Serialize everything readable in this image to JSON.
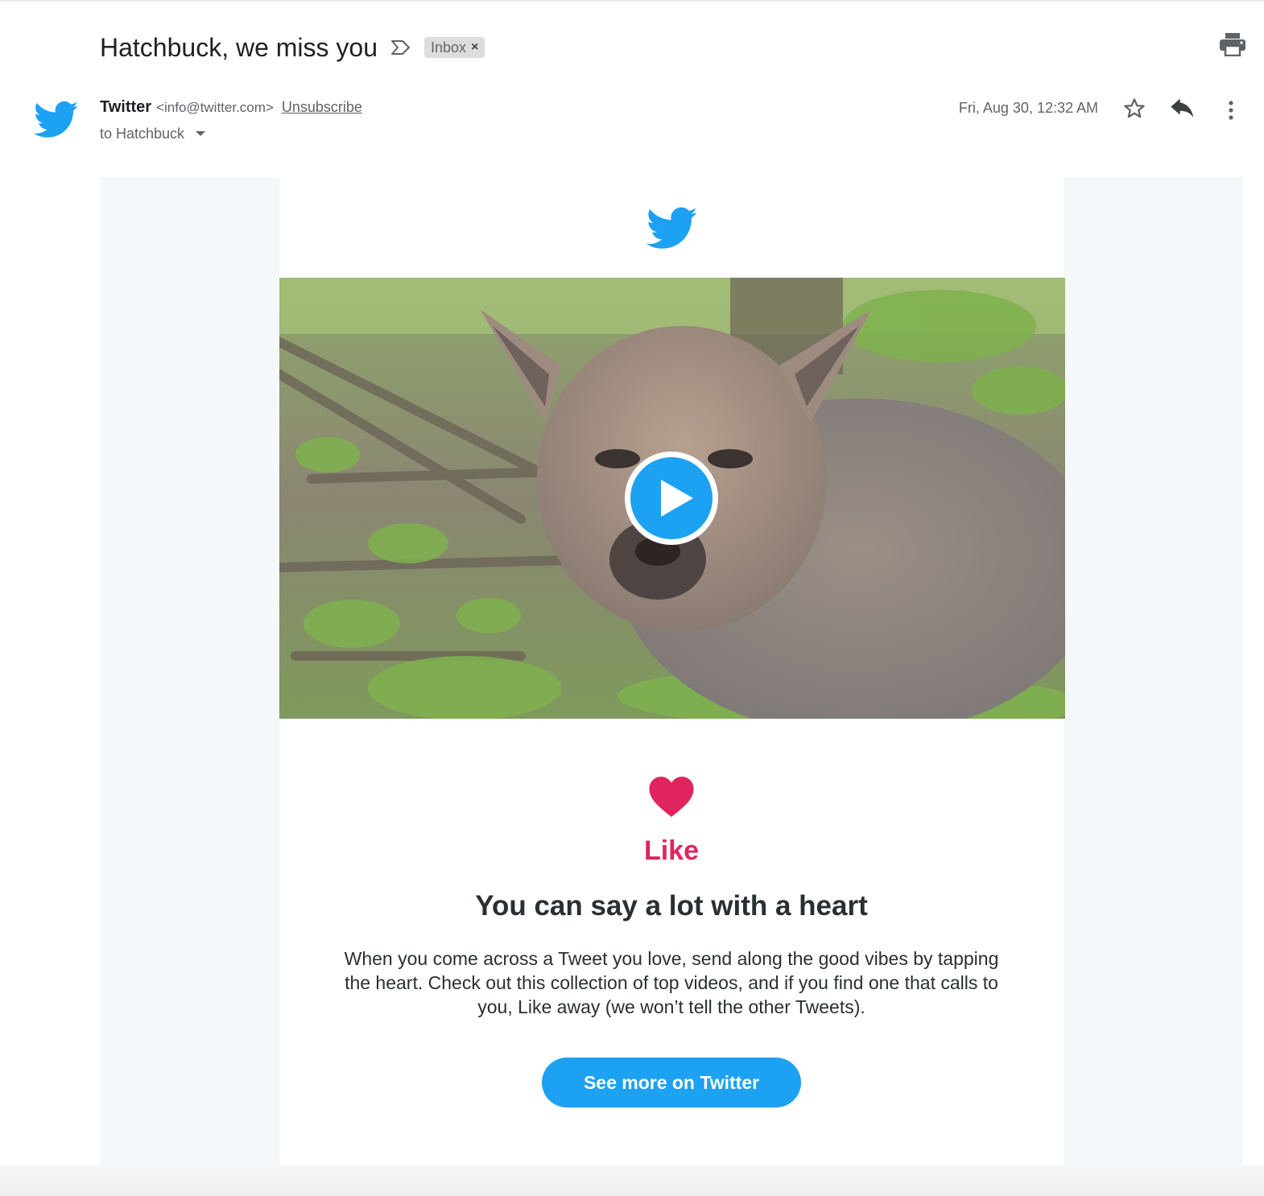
{
  "email": {
    "subject": "Hatchbuck, we miss you",
    "label": "Inbox",
    "label_remove": "×",
    "sender_name": "Twitter",
    "sender_email": "<info@twitter.com>",
    "unsubscribe": "Unsubscribe",
    "recipient": "to Hatchbuck",
    "date": "Fri, Aug 30, 12:32 AM"
  },
  "body": {
    "feature_label": "Like",
    "headline": "You can say a lot with a heart",
    "paragraph": "When you come across a Tweet you love, send along the good vibes by tapping the heart. Check out this collection of top videos, and if you find one that calls to you, Like away (we won’t tell the other Tweets).",
    "cta_label": "See more on Twitter"
  },
  "icons": {
    "importance": "importance-marker-icon",
    "print": "print-icon",
    "avatar": "twitter-bird-icon",
    "star": "star-icon",
    "reply": "reply-icon",
    "more": "more-vert-icon",
    "play": "play-icon",
    "heart": "heart-icon"
  },
  "colors": {
    "twitter_blue": "#1da1f2",
    "like_pink": "#e0245e",
    "text_dark": "#292f33",
    "muted": "#5f6368",
    "email_background": "#f5f8fa"
  }
}
